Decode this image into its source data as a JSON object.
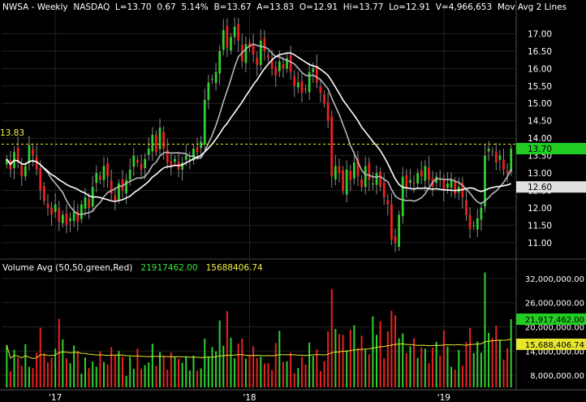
{
  "header": {
    "symbol": "NWSA - Weekly",
    "exchange": "NASDAQ",
    "last": "L=13.70",
    "change": "0.67",
    "change_pct": "5.14%",
    "bid": "B=13.67",
    "ask": "A=13.83",
    "open": "O=12.91",
    "high": "Hi=13.77",
    "low": "Lo=12.91",
    "volume": "V=4,966,653",
    "study": "Mov Avg 2 Lines"
  },
  "volume_header": {
    "label": "Volume Avg (50,50,green,Red)",
    "avg_value": "21917462.00",
    "ma_value": "15688406.74"
  },
  "price_marker_left": "13.83",
  "colors": {
    "up": "#2fd12f",
    "down": "#ee2020",
    "grid": "#222222",
    "ma_fast": "#b8b8b8",
    "ma_slow": "#ffffff",
    "vol_ma": "#e6e62e",
    "dashed": "#e6e62e",
    "last_tag_bg": "#22cc22",
    "ma_tag_bg": "#e0e0e0",
    "vol_tag_bg": "#e6e62e"
  },
  "chart_data": [
    {
      "type": "candlestick",
      "title": "NWSA - Weekly NASDAQ",
      "y_range": [
        10.6,
        17.5
      ],
      "y_ticks": [
        "17.00",
        "16.50",
        "16.00",
        "15.50",
        "15.00",
        "14.50",
        "14.00",
        "13.50",
        "13.00",
        "12.50",
        "12.00",
        "11.50",
        "11.00"
      ],
      "x_ticks": [
        "'17",
        "'18",
        "'19"
      ],
      "dashed_level": 13.83,
      "last_price_tag": "13.70",
      "ma_price_tag": "12.60",
      "weeks_before_2017": 13,
      "close": [
        13.4,
        13.1,
        13.6,
        13.3,
        12.9,
        13.2,
        13.8,
        13.5,
        13.1,
        12.5,
        12.2,
        12.0,
        11.8,
        12.1,
        11.6,
        11.8,
        11.5,
        11.7,
        11.9,
        11.6,
        12.1,
        12.3,
        12.0,
        12.6,
        13.0,
        12.8,
        13.2,
        12.9,
        12.4,
        12.2,
        12.7,
        12.5,
        12.8,
        13.1,
        13.5,
        13.3,
        13.1,
        13.4,
        13.7,
        14.1,
        13.6,
        14.3,
        13.7,
        13.3,
        13.2,
        13.4,
        13.1,
        13.3,
        13.5,
        13.4,
        13.7,
        13.6,
        13.9,
        15.1,
        15.6,
        15.7,
        15.9,
        16.5,
        17.1,
        16.6,
        16.9,
        17.2,
        16.8,
        16.2,
        16.7,
        16.6,
        16.4,
        16.1,
        16.8,
        16.5,
        16.3,
        16.0,
        15.8,
        16.2,
        16.0,
        16.3,
        15.9,
        15.5,
        15.6,
        15.3,
        15.4,
        15.9,
        16.0,
        15.6,
        15.3,
        15.0,
        14.5,
        12.9,
        13.2,
        13.0,
        12.5,
        13.1,
        12.8,
        13.3,
        12.9,
        12.6,
        13.2,
        12.8,
        12.7,
        13.0,
        12.6,
        12.3,
        12.1,
        11.1,
        11.0,
        11.8,
        12.9,
        12.6,
        12.8,
        12.7,
        13.0,
        12.9,
        13.2,
        12.8,
        12.6,
        12.9,
        12.8,
        12.5,
        12.7,
        12.8,
        12.4,
        12.6,
        12.3,
        11.8,
        11.4,
        11.5,
        11.7,
        12.0,
        13.5,
        13.7,
        13.6,
        13.3,
        13.5,
        13.1,
        13.0,
        13.7
      ],
      "volume": [
        15.5,
        9.0,
        14.3,
        12.4,
        10.4,
        15.7,
        10.1,
        9.8,
        13.6,
        19.8,
        13.5,
        11.2,
        12.4,
        14.6,
        22.0,
        16.9,
        12.2,
        11.0,
        15.4,
        14.0,
        8.4,
        12.4,
        9.8,
        11.4,
        10.1,
        13.9,
        11.3,
        10.7,
        15.0,
        13.0,
        14.0,
        12.6,
        7.8,
        12.6,
        9.6,
        14.6,
        9.6,
        10.5,
        11.2,
        15.8,
        10.3,
        13.8,
        12.8,
        9.4,
        13.7,
        12.5,
        12.1,
        11.1,
        12.7,
        9.2,
        12.9,
        9.2,
        9.7,
        17.1,
        12.7,
        15.0,
        13.9,
        21.6,
        15.3,
        23.9,
        17.3,
        12.2,
        15.9,
        17.1,
        12.1,
        13.0,
        15.2,
        12.3,
        12.6,
        10.9,
        11.0,
        9.3,
        16.0,
        19.0,
        11.3,
        11.5,
        13.6,
        8.5,
        9.8,
        12.6,
        10.6,
        16.1,
        12.8,
        14.4,
        9.0,
        11.5,
        18.9,
        29.4,
        19.5,
        18.2,
        18.0,
        14.2,
        19.3,
        20.4,
        14.8,
        17.8,
        14.4,
        13.2,
        22.6,
        18.0,
        21.4,
        12.2,
        18.9,
        24.0,
        22.9,
        17.2,
        18.4,
        13.5,
        15.2,
        17.2,
        12.3,
        14.9,
        14.6,
        11.0,
        14.9,
        16.3,
        12.9,
        19.1,
        15.1,
        10.1,
        9.4,
        14.3,
        10.4,
        16.3,
        19.7,
        13.5,
        16.4,
        13.6,
        33.5,
        18.5,
        17.3,
        20.3,
        16.8,
        11.9,
        14.7,
        21.9
      ],
      "series": [
        {
          "name": "Mov Avg 2 Lines"
        }
      ]
    },
    {
      "type": "bar",
      "title": "Volume Avg (50,50,green,Red)",
      "y_range": [
        5000000,
        34000000
      ],
      "y_ticks": [
        "32,000,000.00",
        "26,000,000.00",
        "20,000,000.00",
        "14,000,000.00",
        "8,000,000.00"
      ],
      "avg_tag": "21,917,462.00",
      "ma_tag": "15,688,406.74"
    }
  ]
}
